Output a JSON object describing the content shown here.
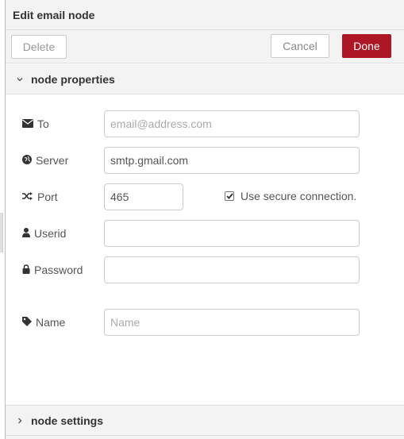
{
  "header": {
    "title": "Edit email node"
  },
  "toolbar": {
    "delete_label": "Delete",
    "cancel_label": "Cancel",
    "done_label": "Done"
  },
  "colors": {
    "done_bg": "#ad1625",
    "panel_bg": "#f3f3f3"
  },
  "sections": {
    "properties": {
      "label": "node properties",
      "expanded": true,
      "icon": "chevron-down-icon"
    },
    "settings": {
      "label": "node settings",
      "expanded": false,
      "icon": "chevron-right-icon"
    }
  },
  "form": {
    "to": {
      "label": "To",
      "value": "",
      "placeholder": "email@address.com",
      "icon": "envelope-icon"
    },
    "server": {
      "label": "Server",
      "value": "smtp.gmail.com",
      "placeholder": "",
      "icon": "globe-icon"
    },
    "port": {
      "label": "Port",
      "value": "465",
      "placeholder": "",
      "icon": "random-icon"
    },
    "secure": {
      "label": "Use secure connection.",
      "checked": true
    },
    "userid": {
      "label": "Userid",
      "value": "",
      "placeholder": "",
      "icon": "user-icon"
    },
    "password": {
      "label": "Password",
      "value": "",
      "placeholder": "",
      "icon": "lock-icon"
    },
    "name": {
      "label": "Name",
      "value": "",
      "placeholder": "Name",
      "icon": "tag-icon"
    }
  }
}
